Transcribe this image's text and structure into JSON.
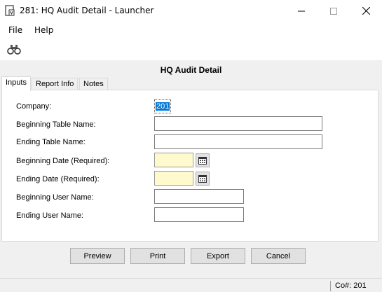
{
  "window": {
    "title": "281: HQ Audit Detail - Launcher",
    "minimize_icon": "minimize-icon",
    "maximize_icon": "maximize-icon",
    "close_icon": "close-icon"
  },
  "menu": {
    "items": [
      "File",
      "Help"
    ]
  },
  "toolbar": {
    "lookup_icon": "binoculars-icon"
  },
  "form": {
    "title": "HQ Audit Detail",
    "tabs": [
      {
        "label": "Inputs",
        "active": true
      },
      {
        "label": "Report Info",
        "active": false
      },
      {
        "label": "Notes",
        "active": false
      }
    ],
    "fields": {
      "company": {
        "label": "Company:",
        "value": "201"
      },
      "beginning_table": {
        "label": "Beginning Table Name:",
        "value": ""
      },
      "ending_table": {
        "label": "Ending Table Name:",
        "value": ""
      },
      "beginning_date": {
        "label": "Beginning Date (Required):",
        "value": ""
      },
      "ending_date": {
        "label": "Ending Date (Required):",
        "value": ""
      },
      "beginning_user": {
        "label": "Beginning User Name:",
        "value": ""
      },
      "ending_user": {
        "label": "Ending User Name:",
        "value": ""
      }
    },
    "required_color": "#fffacd",
    "selection_color": "#0078d7"
  },
  "buttons": {
    "preview": "Preview",
    "print": "Print",
    "export": "Export",
    "cancel": "Cancel"
  },
  "status": {
    "company": "Co#: 201"
  }
}
